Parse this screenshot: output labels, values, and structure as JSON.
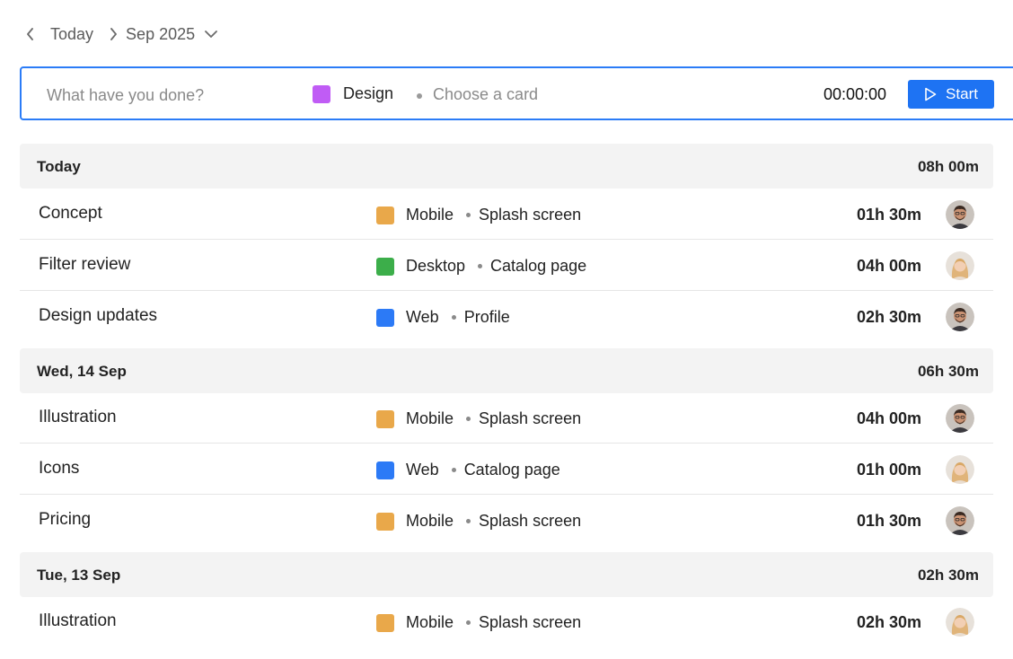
{
  "nav": {
    "today_label": "Today",
    "month_label": "Sep 2025"
  },
  "entry": {
    "placeholder": "What have you done?",
    "project_name": "Design",
    "project_color": "#c05cf5",
    "card_placeholder": "Choose a card",
    "timer": "00:00:00",
    "start_label": "Start"
  },
  "groups": [
    {
      "date": "Today",
      "total": "08h 00m",
      "entries": [
        {
          "task": "Concept",
          "project": "Mobile",
          "color": "#e9a84a",
          "card": "Splash screen",
          "duration": "01h 30m",
          "avatar": "man"
        },
        {
          "task": "Filter review",
          "project": "Desktop",
          "color": "#3cae4a",
          "card": "Catalog page",
          "duration": "04h 00m",
          "avatar": "woman"
        },
        {
          "task": "Design updates",
          "project": "Web",
          "color": "#2c7af6",
          "card": "Profile",
          "duration": "02h 30m",
          "avatar": "man"
        }
      ]
    },
    {
      "date": "Wed, 14 Sep",
      "total": "06h 30m",
      "entries": [
        {
          "task": "Illustration",
          "project": "Mobile",
          "color": "#e9a84a",
          "card": "Splash screen",
          "duration": "04h 00m",
          "avatar": "man"
        },
        {
          "task": "Icons",
          "project": "Web",
          "color": "#2c7af6",
          "card": "Catalog page",
          "duration": "01h 00m",
          "avatar": "woman"
        },
        {
          "task": "Pricing",
          "project": "Mobile",
          "color": "#e9a84a",
          "card": "Splash screen",
          "duration": "01h 30m",
          "avatar": "man"
        }
      ]
    },
    {
      "date": "Tue, 13 Sep",
      "total": "02h 30m",
      "entries": [
        {
          "task": "Illustration",
          "project": "Mobile",
          "color": "#e9a84a",
          "card": "Splash screen",
          "duration": "02h 30m",
          "avatar": "woman"
        }
      ]
    }
  ]
}
